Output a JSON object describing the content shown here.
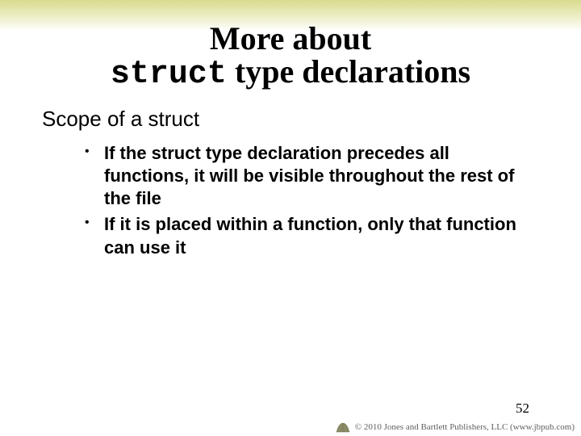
{
  "title": {
    "line1": "More about",
    "struct_word": "struct",
    "line2_rest": " type declarations"
  },
  "subheading": "Scope of a struct",
  "bullets": [
    "If the struct type declaration precedes all functions, it will be visible throughout the rest of the file",
    "If it is placed within a function, only that function can use it"
  ],
  "page_number": "52",
  "footer_credit": "© 2010 Jones and Bartlett Publishers, LLC (www.jbpub.com)"
}
